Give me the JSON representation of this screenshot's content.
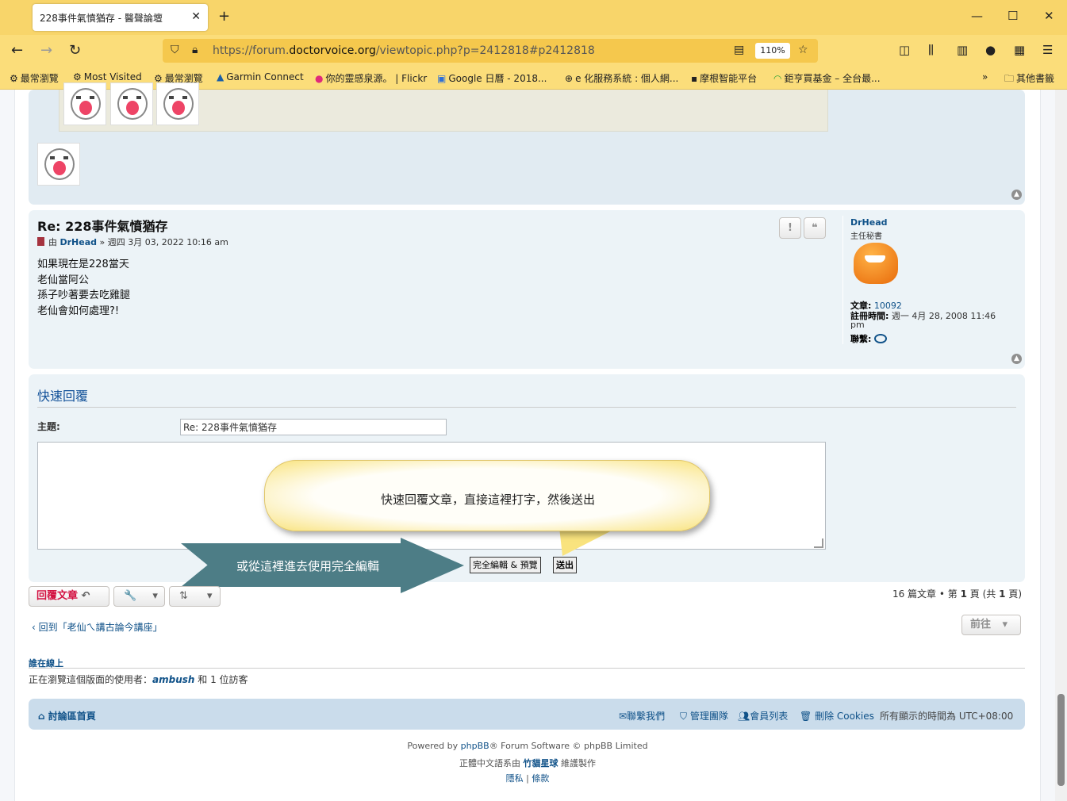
{
  "browser": {
    "tab_title": "228事件氣憤猶存 - 醫聲論壇",
    "url_prefix": "https://forum.",
    "url_domain": "doctorvoice.org",
    "url_path": "/viewtopic.php?p=2412818#p2412818",
    "zoom": "110%",
    "bookmarks": [
      "最常瀏覽",
      "Most Visited",
      "最常瀏覽",
      "Garmin Connect",
      "你的靈感泉源。 | Flickr",
      "Google 日曆 - 2018...",
      "e 化服務系統 : 個人網...",
      "摩根智能平台",
      "鉅亨買基金 – 全台最...",
      "其他書籤"
    ]
  },
  "post": {
    "title": "Re: 228事件氣憤猶存",
    "by_label": "由",
    "author": "DrHead",
    "date": "» 週四 3月 03, 2022 10:16 am",
    "body": [
      "如果現在是228當天",
      "老仙當阿公",
      "孫子吵著要去吃雞腿",
      "老仙會如何處理?!"
    ],
    "report_icon": "!",
    "quote_icon": "❝"
  },
  "profile": {
    "name": "DrHead",
    "rank": "主任秘書",
    "posts_label": "文章:",
    "posts_value": "10092",
    "joined_label": "註冊時間:",
    "joined_value": "週一 4月 28, 2008 11:46",
    "joined_value2": "pm",
    "contact_label": "聯繫:"
  },
  "quick_reply": {
    "title": "快速回覆",
    "subject_label": "主題:",
    "subject_value": "Re: 228事件氣憤猶存",
    "full_editor_button": "完全編輯 & 預覽",
    "submit_button": "送出",
    "bubble_text": "快速回覆文章，直接這裡打字，然後送出",
    "arrow_text": "或從這裡進去使用完全編輯"
  },
  "actions": {
    "reply_button": "回覆文章",
    "reply_icon": "↶",
    "tools_icon": "🔧",
    "sort_icon": "⇅",
    "dropdown_icon": "▾"
  },
  "pagination": {
    "count": "16 篇文章",
    "sep": "•",
    "page_label": "第",
    "page_current": "1",
    "page_total_prefix": "頁 (共",
    "page_total": "1",
    "page_suffix": "頁)"
  },
  "navigation": {
    "back_link": "回到「老仙ㄟ講古論今講座」",
    "goto_button": "前往"
  },
  "online": {
    "title": "誰在線上",
    "text_prefix": "正在瀏覽這個版面的使用者：",
    "user": "ambush",
    "text_suffix": "和 1 位訪客"
  },
  "footer": {
    "home": "討論區首頁",
    "contact": "聯繫我們",
    "team": "管理團隊",
    "members": "會員列表",
    "cookies": "刪除 Cookies",
    "timezone": "所有顯示的時間為 UTC+08:00",
    "powered_prefix": "Powered by",
    "powered_link": "phpBB",
    "powered_suffix": "® Forum Software © phpBB Limited",
    "translation_prefix": "正體中文語系由",
    "translation_link": "竹貓星球",
    "translation_suffix": "維護製作",
    "privacy": "隱私",
    "separator": "|",
    "terms": "條款"
  },
  "colors": {
    "accent": "#105289",
    "reply_red": "#d31141",
    "browser_yellow": "#f8d56a",
    "arrow_teal": "#4d7d86"
  }
}
